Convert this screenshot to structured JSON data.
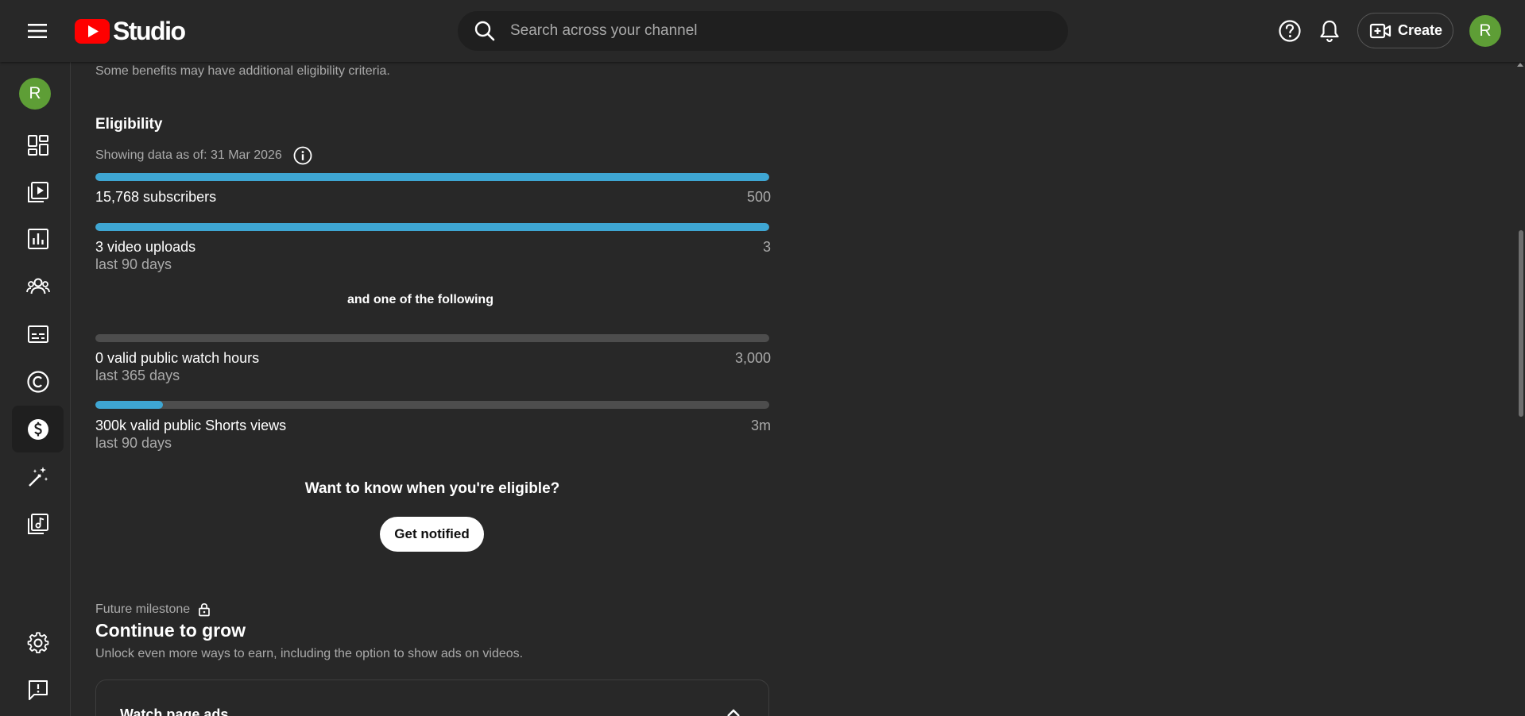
{
  "header": {
    "logo_text": "Studio",
    "search_placeholder": "Search across your channel",
    "create_label": "Create",
    "avatar_letter": "R"
  },
  "sidebar": {
    "avatar_letter": "R",
    "items": [
      {
        "name": "dashboard-icon"
      },
      {
        "name": "content-icon"
      },
      {
        "name": "analytics-icon"
      },
      {
        "name": "community-icon"
      },
      {
        "name": "subtitles-icon"
      },
      {
        "name": "copyright-icon"
      },
      {
        "name": "earn-icon",
        "active": true
      },
      {
        "name": "customization-icon"
      },
      {
        "name": "audio-library-icon"
      }
    ]
  },
  "main": {
    "benefits_note": "Some benefits may have additional eligibility criteria.",
    "eligibility_title": "Eligibility",
    "showing_data": "Showing data as of: 31 Mar 2026",
    "requirements": [
      {
        "label": "15,768 subscribers",
        "sub": "",
        "target": "500",
        "progress": 1.0
      },
      {
        "label": "3 video uploads",
        "sub": "last 90 days",
        "target": "3",
        "progress": 1.0
      }
    ],
    "and_one": "and one of the following",
    "alternatives": [
      {
        "label": "0 valid public watch hours",
        "sub": "last 365 days",
        "target": "3,000",
        "progress": 0.0
      },
      {
        "label": "300k valid public Shorts views",
        "sub": "last 90 days",
        "target": "3m",
        "progress": 0.1
      }
    ],
    "want_to_know": "Want to know when you're eligible?",
    "get_notified": "Get notified",
    "future_milestone": "Future milestone",
    "continue_title": "Continue to grow",
    "unlock_text": "Unlock even more ways to earn, including the option to show ads on videos.",
    "card_title": "Watch page ads"
  },
  "colors": {
    "background": "#282828",
    "progress": "#3ea6d3",
    "track": "#4d4d4d",
    "avatar": "#5e9e36",
    "brand_red": "#ff0000"
  }
}
